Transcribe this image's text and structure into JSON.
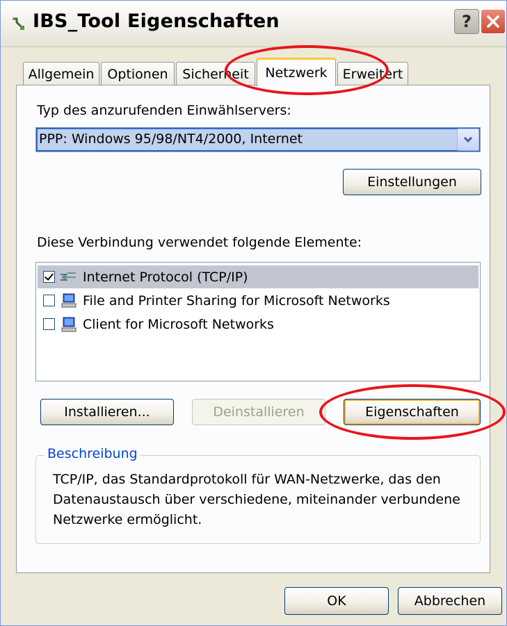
{
  "window": {
    "title": "IBS_Tool Eigenschaften",
    "help_button": "?",
    "accent_color": "#e8141c"
  },
  "tabs": [
    {
      "label": "Allgemein",
      "active": false
    },
    {
      "label": "Optionen",
      "active": false
    },
    {
      "label": "Sicherheit",
      "active": false
    },
    {
      "label": "Netzwerk",
      "active": true
    },
    {
      "label": "Erweitert",
      "active": false
    }
  ],
  "server_type": {
    "label": "Typ des anzurufenden Einwählservers:",
    "selected_value": "PPP: Windows 95/98/NT4/2000, Internet",
    "settings_button": "Einstellungen"
  },
  "elements": {
    "label": "Diese Verbindung verwendet folgende Elemente:",
    "items": [
      {
        "label": "Internet Protocol (TCP/IP)",
        "checked": true,
        "icon": "network-protocol-icon"
      },
      {
        "label": "File and Printer Sharing for Microsoft Networks",
        "checked": false,
        "icon": "computer-icon"
      },
      {
        "label": "Client for Microsoft Networks",
        "checked": false,
        "icon": "computer-icon"
      }
    ]
  },
  "actions": {
    "install": "Installieren...",
    "uninstall": "Deinstallieren",
    "properties": "Eigenschaften"
  },
  "description": {
    "title": "Beschreibung",
    "text": "TCP/IP, das Standardprotokoll für WAN-Netzwerke, das den Datenaustausch über verschiedene, miteinander verbundene Netzwerke ermöglicht."
  },
  "footer": {
    "ok": "OK",
    "cancel": "Abbrechen"
  }
}
